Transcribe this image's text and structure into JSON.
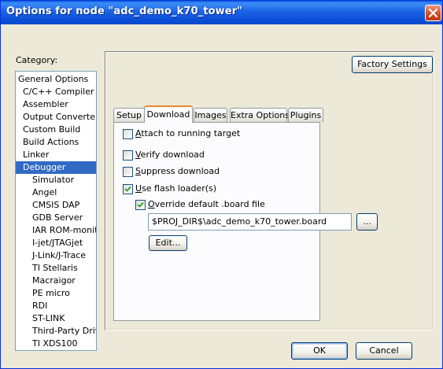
{
  "window": {
    "title": "Options for node \"adc_demo_k70_tower\""
  },
  "category": {
    "label": "Category:",
    "items": [
      {
        "label": "General Options",
        "indent": 0,
        "selected": false
      },
      {
        "label": "C/C++ Compiler",
        "indent": 1,
        "selected": false
      },
      {
        "label": "Assembler",
        "indent": 1,
        "selected": false
      },
      {
        "label": "Output Converter",
        "indent": 1,
        "selected": false
      },
      {
        "label": "Custom Build",
        "indent": 1,
        "selected": false
      },
      {
        "label": "Build Actions",
        "indent": 1,
        "selected": false
      },
      {
        "label": "Linker",
        "indent": 1,
        "selected": false
      },
      {
        "label": "Debugger",
        "indent": 1,
        "selected": true
      },
      {
        "label": "Simulator",
        "indent": 2,
        "selected": false
      },
      {
        "label": "Angel",
        "indent": 2,
        "selected": false
      },
      {
        "label": "CMSIS DAP",
        "indent": 2,
        "selected": false
      },
      {
        "label": "GDB Server",
        "indent": 2,
        "selected": false
      },
      {
        "label": "IAR ROM-monitor",
        "indent": 2,
        "selected": false
      },
      {
        "label": "I-jet/JTAGjet",
        "indent": 2,
        "selected": false
      },
      {
        "label": "J-Link/J-Trace",
        "indent": 2,
        "selected": false
      },
      {
        "label": "TI Stellaris",
        "indent": 2,
        "selected": false
      },
      {
        "label": "Macraigor",
        "indent": 2,
        "selected": false
      },
      {
        "label": "PE micro",
        "indent": 2,
        "selected": false
      },
      {
        "label": "RDI",
        "indent": 2,
        "selected": false
      },
      {
        "label": "ST-LINK",
        "indent": 2,
        "selected": false
      },
      {
        "label": "Third-Party Driver",
        "indent": 2,
        "selected": false
      },
      {
        "label": "TI XDS100",
        "indent": 2,
        "selected": false
      }
    ]
  },
  "factory_settings_label": "Factory Settings",
  "tabs": [
    {
      "label": "Setup",
      "active": false
    },
    {
      "label": "Download",
      "active": true
    },
    {
      "label": "Images",
      "active": false
    },
    {
      "label": "Extra Options",
      "active": false
    },
    {
      "label": "Plugins",
      "active": false
    }
  ],
  "download": {
    "attach": {
      "label": "Attach to running target",
      "mnemonic": "A",
      "rest": "ttach to running target",
      "checked": false
    },
    "verify": {
      "label": "Verify download",
      "mnemonic": "V",
      "rest": "erify download",
      "checked": false
    },
    "suppress": {
      "label": "Suppress download",
      "mnemonic": "S",
      "rest": "uppress download",
      "checked": false
    },
    "flash": {
      "label": "Use flash loader(s)",
      "mnemonic": "U",
      "rest": "se flash loader(s)",
      "checked": true
    },
    "override": {
      "label": "Override default .board file",
      "mnemonic": "O",
      "rest": "verride default .board file",
      "checked": true
    },
    "board_file_path": "$PROJ_DIR$\\adc_demo_k70_tower.board",
    "browse_label": "...",
    "edit_label": "Edit..."
  },
  "ok_label": "OK",
  "cancel_label": "Cancel"
}
